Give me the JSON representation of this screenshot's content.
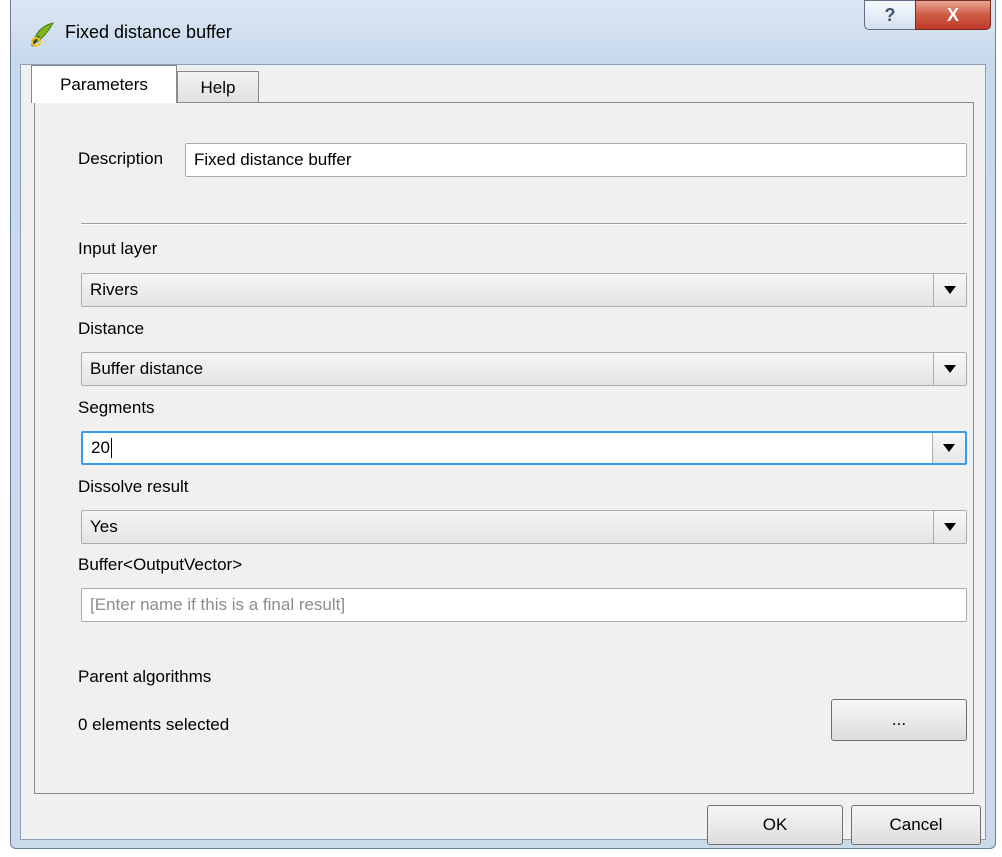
{
  "window": {
    "title": "Fixed distance buffer",
    "help_glyph": "?",
    "close_glyph": "X"
  },
  "tabs": [
    {
      "label": "Parameters",
      "active": true
    },
    {
      "label": "Help",
      "active": false
    }
  ],
  "form": {
    "description_label": "Description",
    "description_value": "Fixed distance buffer",
    "input_layer_label": "Input layer",
    "input_layer_value": "Rivers",
    "distance_label": "Distance",
    "distance_value": "Buffer distance",
    "segments_label": "Segments",
    "segments_value": "20",
    "dissolve_label": "Dissolve result",
    "dissolve_value": "Yes",
    "output_label": "Buffer<OutputVector>",
    "output_placeholder": "[Enter name if this is a final result]",
    "parent_label": "Parent algorithms",
    "parent_count_text": "0 elements selected",
    "parent_button_label": "..."
  },
  "footer": {
    "ok_label": "OK",
    "cancel_label": "Cancel"
  },
  "colors": {
    "focus_border": "#3c9be6",
    "close_button": "#c0392a"
  },
  "icons": {
    "app": "qgis-logo-icon",
    "dropdown": "chevron-down-icon"
  }
}
